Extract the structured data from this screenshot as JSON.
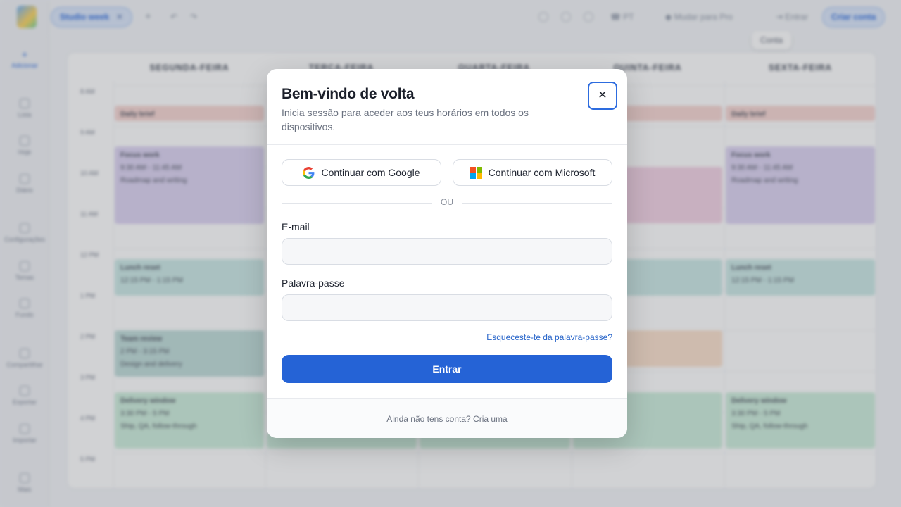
{
  "sidebar": {
    "items": [
      {
        "label": "Adicionar",
        "icon": "plus-icon"
      },
      {
        "label": "Lista",
        "icon": "list-icon"
      },
      {
        "label": "Hoje",
        "icon": "today-icon"
      },
      {
        "label": "Diário",
        "icon": "calendar-icon"
      },
      {
        "label": "Configurações",
        "icon": "gear-icon"
      },
      {
        "label": "Temas",
        "icon": "palette-icon"
      },
      {
        "label": "Fundo",
        "icon": "image-icon"
      },
      {
        "label": "Compartilhar",
        "icon": "share-icon"
      },
      {
        "label": "Exportar",
        "icon": "export-icon"
      },
      {
        "label": "Importar",
        "icon": "import-icon"
      },
      {
        "label": "Mais",
        "icon": "more-icon"
      }
    ]
  },
  "topbar": {
    "tab_label": "Studio week",
    "language": "PT",
    "pro_label": "Mudar para Pro",
    "signin_label": "Entrar",
    "create_account_label": "Criar conta",
    "tooltip": "Conta"
  },
  "calendar": {
    "days": [
      "SEGUNDA-FEIRA",
      "TERÇA-FEIRA",
      "QUARTA-FEIRA",
      "QUINTA-FEIRA",
      "SEXTA-FEIRA"
    ],
    "hours": [
      "8 AM",
      "9 AM",
      "10 AM",
      "11 AM",
      "12 PM",
      "1 PM",
      "2 PM",
      "3 PM",
      "4 PM",
      "5 PM"
    ],
    "events": {
      "daily_brief": "Daily brief",
      "focus_work": "Focus work",
      "focus_time": "9:30 AM - 11:45 AM",
      "focus_note": "Roadmap and writing",
      "lunch_reset": "Lunch reset",
      "lunch_time": "12:15 PM - 1:15 PM",
      "team_review": "Team review",
      "team_time": "2 PM - 3:15 PM",
      "team_note": "Design and delivery",
      "delivery": "Delivery window",
      "delivery_time": "3:30 PM - 5 PM",
      "delivery_note": "Ship, QA, follow-through"
    }
  },
  "modal": {
    "title": "Bem-vindo de volta",
    "subtitle": "Inicia sessão para aceder aos teus horários em todos os dispositivos.",
    "close_symbol": "✕",
    "google_label": "Continuar com Google",
    "microsoft_label": "Continuar com Microsoft",
    "or_label": "OU",
    "email_label": "E-mail",
    "email_value": "",
    "password_label": "Palavra-passe",
    "password_value": "",
    "forgot_label": "Esqueceste-te da palavra-passe?",
    "submit_label": "Entrar",
    "footer_text": "Ainda não tens conta? Cria uma"
  },
  "colors": {
    "accent": "#2563d6",
    "link": "#2563c9"
  }
}
